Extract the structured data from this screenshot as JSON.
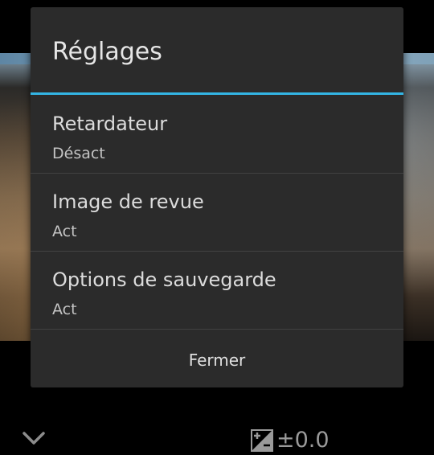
{
  "dialog": {
    "title": "Réglages",
    "accent_color": "#33b5e5",
    "items": [
      {
        "label": "Retardateur",
        "value": "Désact"
      },
      {
        "label": "Image de revue",
        "value": "Act"
      },
      {
        "label": "Options de sauvegarde",
        "value": "Act"
      }
    ],
    "close_label": "Fermer"
  },
  "camera_controls": {
    "collapse_icon": "chevron-down-icon",
    "exposure_icon": "exposure-compensation-icon",
    "exposure_value": "±0.0"
  }
}
